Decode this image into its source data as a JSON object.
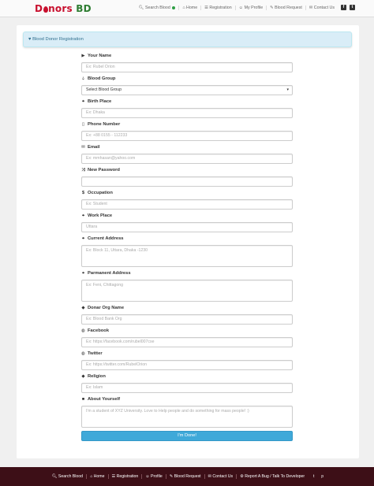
{
  "brand": {
    "part1": "D",
    "part2": "nors",
    "part3": "BD"
  },
  "nav": {
    "search": "Search Blood",
    "home": "Home",
    "registration": "Registration",
    "profile": "My Profile",
    "request": "Blood Request",
    "contact": "Contact Us"
  },
  "panel": {
    "title": "Blood Donor Registration"
  },
  "form": {
    "name_label": "Your Name",
    "name_placeholder": "Ex: Rubel Orion",
    "blood_label": "Blood Group",
    "blood_selected": "Select Blood Group",
    "birth_label": "Birth Place",
    "birth_placeholder": "Ex: Dhaka",
    "phone_label": "Phone Number",
    "phone_placeholder": "Ex: +88 0155 - 112233",
    "email_label": "Email",
    "email_placeholder": "Ex: mmhasan@yahoo.com",
    "password_label": "New Password",
    "occupation_label": "Occupation",
    "occupation_placeholder": "Ex: Student",
    "work_label": "Work Place",
    "work_placeholder": "Uttara",
    "current_label": "Current Address",
    "current_placeholder": "Ex: Block 11, Uttara, Dhaka -1230",
    "permanent_label": "Parmanent Address",
    "permanent_placeholder": "Ex: Feni, Chittagong",
    "org_label": "Donar Org Name",
    "org_placeholder": "Ex: Blood Bank Org",
    "facebook_label": "Facebook",
    "facebook_placeholder": "Ex: https://facebook.com/rubel007cse",
    "twitter_label": "Twitter",
    "twitter_placeholder": "Ex: https://twitter.com/RubelOrion",
    "religion_label": "Religion",
    "religion_placeholder": "Ex: Islam",
    "about_label": "About Yourself",
    "about_placeholder": "I'm a student of XYZ University. Love to Help people and do something for mass people! :)",
    "submit": "I'm Done!"
  },
  "footer": {
    "search": "Search Blood",
    "home": "Home",
    "registration": "Registration",
    "profile": "Profile",
    "request": "Blood Request",
    "contact": "Contact Us",
    "report": "Report A Bug / Talk To Developer"
  }
}
